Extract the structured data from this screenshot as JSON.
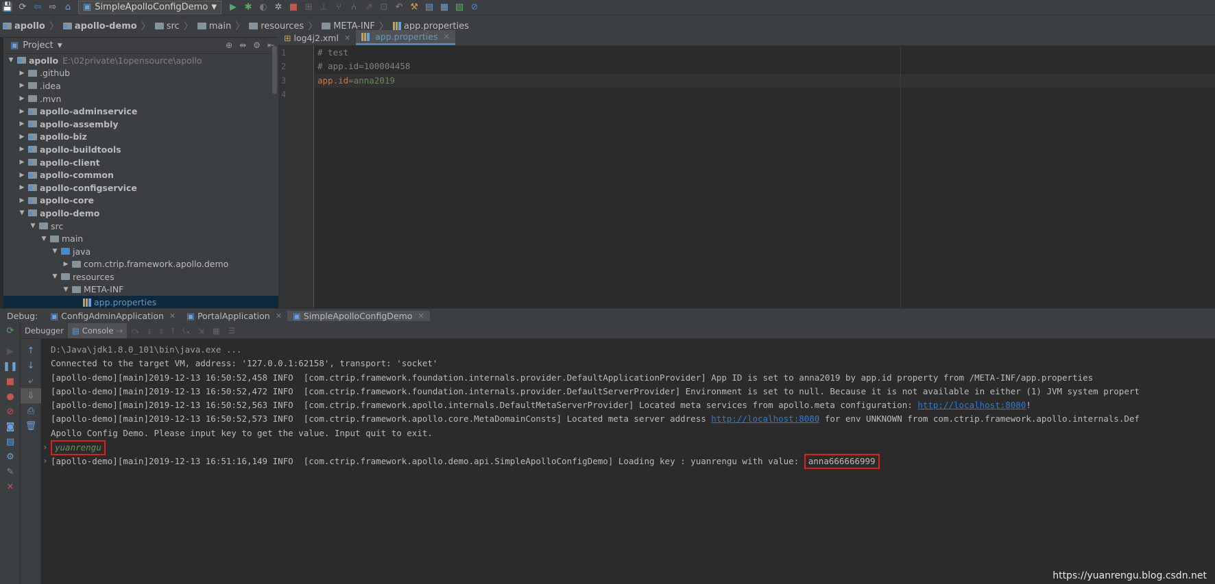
{
  "toolbar": {
    "run_config": "SimpleApolloConfigDemo"
  },
  "breadcrumb": [
    "apollo",
    "apollo-demo",
    "src",
    "main",
    "resources",
    "META-INF",
    "app.properties"
  ],
  "project": {
    "title": "Project",
    "tree": [
      {
        "label": "apollo",
        "path": "E:\\02private\\1opensource\\apollo",
        "depth": 0,
        "open": true,
        "bold": true
      },
      {
        "label": ".github",
        "depth": 1
      },
      {
        "label": ".idea",
        "depth": 1
      },
      {
        "label": ".mvn",
        "depth": 1
      },
      {
        "label": "apollo-adminservice",
        "depth": 1,
        "bold": true
      },
      {
        "label": "apollo-assembly",
        "depth": 1,
        "bold": true
      },
      {
        "label": "apollo-biz",
        "depth": 1,
        "bold": true
      },
      {
        "label": "apollo-buildtools",
        "depth": 1,
        "bold": true
      },
      {
        "label": "apollo-client",
        "depth": 1,
        "bold": true
      },
      {
        "label": "apollo-common",
        "depth": 1,
        "bold": true
      },
      {
        "label": "apollo-configservice",
        "depth": 1,
        "bold": true
      },
      {
        "label": "apollo-core",
        "depth": 1,
        "bold": true
      },
      {
        "label": "apollo-demo",
        "depth": 1,
        "bold": true,
        "open": true
      },
      {
        "label": "src",
        "depth": 2,
        "open": true
      },
      {
        "label": "main",
        "depth": 3,
        "open": true
      },
      {
        "label": "java",
        "depth": 4,
        "open": true
      },
      {
        "label": "com.ctrip.framework.apollo.demo",
        "depth": 5
      },
      {
        "label": "resources",
        "depth": 4,
        "open": true
      },
      {
        "label": "META-INF",
        "depth": 5,
        "open": true
      },
      {
        "label": "app.properties",
        "depth": 6,
        "selected": true
      }
    ]
  },
  "editor": {
    "tabs": [
      {
        "label": "log4j2.xml",
        "active": false
      },
      {
        "label": "app.properties",
        "active": true
      }
    ],
    "line_numbers": [
      "1",
      "2",
      "3",
      "4"
    ],
    "lines": {
      "l1": "# test",
      "l2": "# app.id=100004458",
      "l3_key": "app.id",
      "l3_eq": "=",
      "l3_val": "anna2019"
    }
  },
  "debug": {
    "label": "Debug:",
    "tabs": [
      "ConfigAdminApplication",
      "PortalApplication",
      "SimpleApolloConfigDemo"
    ],
    "debugger": "Debugger",
    "console_tab": "Console"
  },
  "console": {
    "l1": "D:\\Java\\jdk1.8.0_101\\bin\\java.exe ...",
    "l2": "Connected to the target VM, address: '127.0.0.1:62158', transport: 'socket'",
    "l3": "[apollo-demo][main]2019-12-13 16:50:52,458 INFO  [com.ctrip.framework.foundation.internals.provider.DefaultApplicationProvider] App ID is set to anna2019 by app.id property from /META-INF/app.properties",
    "l4": "[apollo-demo][main]2019-12-13 16:50:52,472 INFO  [com.ctrip.framework.foundation.internals.provider.DefaultServerProvider] Environment is set to null. Because it is not available in either (1) JVM system propert",
    "l5_pre": "[apollo-demo][main]2019-12-13 16:50:52,563 INFO  [com.ctrip.framework.apollo.internals.DefaultMetaServerProvider] Located meta services from apollo.meta configuration: ",
    "l5_link": "http://localhost:8080",
    "l5_post": "!",
    "l6_pre": "[apollo-demo][main]2019-12-13 16:50:52,573 INFO  [com.ctrip.framework.apollo.core.MetaDomainConsts] Located meta server address ",
    "l6_link": "http://localhost:8080",
    "l6_post": " for env UNKNOWN from com.ctrip.framework.apollo.internals.Def",
    "l7": "Apollo Config Demo. Please input key to get the value. Input quit to exit.",
    "input": "yuanrengu",
    "l9_pre": "[apollo-demo][main]2019-12-13 16:51:16,149 INFO  [com.ctrip.framework.apollo.demo.api.SimpleApolloConfigDemo] Loading key : yuanrengu with value: ",
    "l9_value": "anna666666999"
  },
  "watermark": "https://yuanrengu.blog.csdn.net"
}
